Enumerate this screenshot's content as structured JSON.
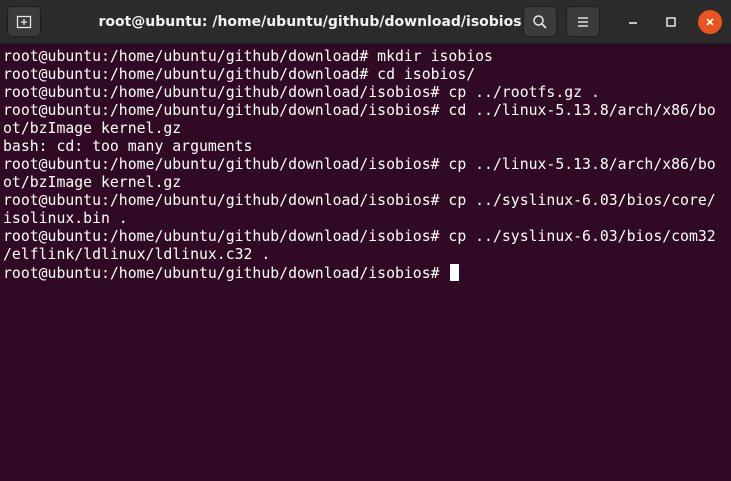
{
  "window": {
    "title": "root@ubuntu: /home/ubuntu/github/download/isobios"
  },
  "titlebar": {
    "new_tab_icon": "new-tab-icon",
    "search_icon": "search-icon",
    "menu_icon": "hamburger-menu-icon",
    "minimize_icon": "minimize-icon",
    "maximize_icon": "maximize-icon",
    "close_icon": "close-icon"
  },
  "colors": {
    "terminal_background": "#300a24",
    "titlebar_background": "#2b2b2b",
    "close_button": "#e95420",
    "text": "#ffffff"
  },
  "terminal": {
    "lines": [
      "root@ubuntu:/home/ubuntu/github/download# mkdir isobios",
      "root@ubuntu:/home/ubuntu/github/download# cd isobios/",
      "root@ubuntu:/home/ubuntu/github/download/isobios# cp ../rootfs.gz .",
      "root@ubuntu:/home/ubuntu/github/download/isobios# cd ../linux-5.13.8/arch/x86/bo",
      "ot/bzImage kernel.gz",
      "bash: cd: too many arguments",
      "root@ubuntu:/home/ubuntu/github/download/isobios# cp ../linux-5.13.8/arch/x86/bo",
      "ot/bzImage kernel.gz",
      "root@ubuntu:/home/ubuntu/github/download/isobios# cp ../syslinux-6.03/bios/core/",
      "isolinux.bin .",
      "root@ubuntu:/home/ubuntu/github/download/isobios# cp ../syslinux-6.03/bios/com32",
      "/elflink/ldlinux/ldlinux.c32 ."
    ],
    "prompt": "root@ubuntu:/home/ubuntu/github/download/isobios# "
  }
}
